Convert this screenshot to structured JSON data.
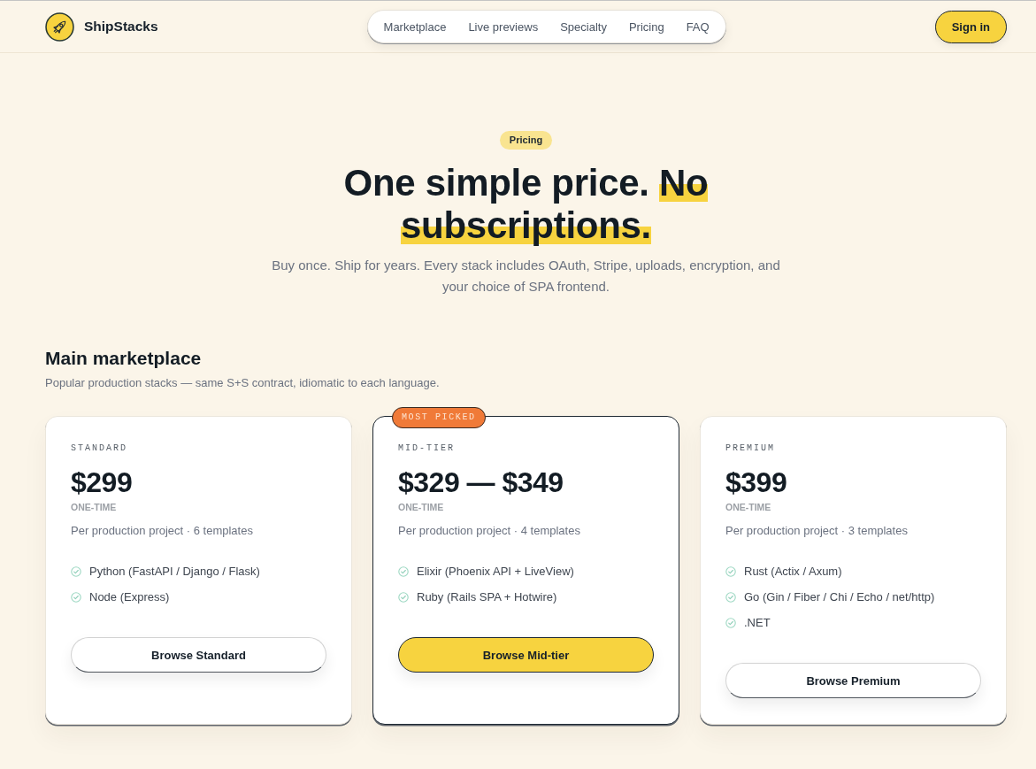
{
  "header": {
    "brand": "ShipStacks",
    "nav": [
      "Marketplace",
      "Live previews",
      "Specialty",
      "Pricing",
      "FAQ"
    ],
    "sign_in": "Sign in"
  },
  "hero": {
    "badge": "Pricing",
    "title": [
      {
        "text": "One simple price.",
        "highlighted": false
      },
      {
        "text": "No subscriptions.",
        "highlighted": true
      }
    ],
    "subtitle": "Buy once. Ship for years. Every stack includes OAuth, Stripe, uploads, encryption, and your choice of SPA frontend."
  },
  "section": {
    "title": "Main marketplace",
    "subtitle": "Popular production stacks — same S+S contract, idiomatic to each language.",
    "plans": [
      {
        "tier": "STANDARD",
        "price": "$299",
        "billing": "ONE-TIME",
        "description": "Per production project · 6 templates",
        "features": [
          "Python (FastAPI / Django / Flask)",
          "Node (Express)"
        ],
        "button": "Browse Standard",
        "featured": false
      },
      {
        "badge": "MOST PICKED",
        "tier": "MID-TIER",
        "price": "$329 — $349",
        "billing": "ONE-TIME",
        "description": "Per production project · 4 templates",
        "features": [
          "Elixir (Phoenix API + LiveView)",
          "Ruby (Rails SPA + Hotwire)"
        ],
        "button": "Browse Mid-tier",
        "featured": true
      },
      {
        "tier": "PREMIUM",
        "price": "$399",
        "billing": "ONE-TIME",
        "description": "Per production project · 3 templates",
        "features": [
          "Rust (Actix / Axum)",
          "Go (Gin / Fiber / Chi / Echo / net/http)",
          ".NET"
        ],
        "button": "Browse Premium",
        "featured": false
      }
    ]
  }
}
